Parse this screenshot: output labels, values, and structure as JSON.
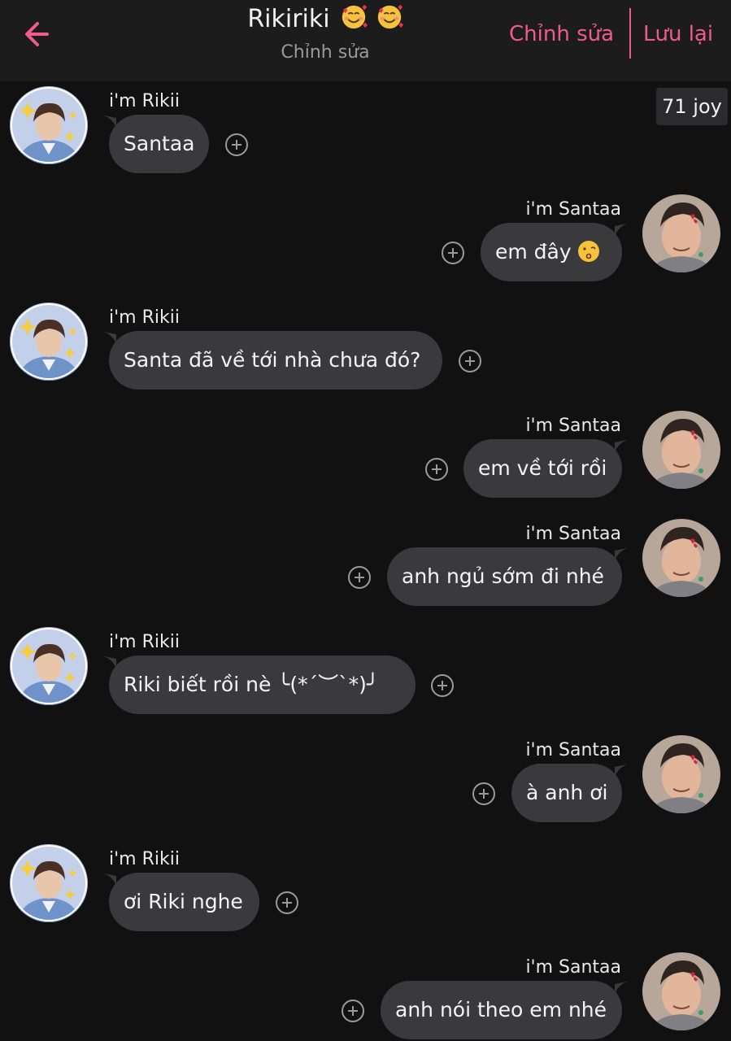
{
  "header": {
    "back_icon": "arrow-left-icon",
    "title": "Rikiriki",
    "title_emoji": "smiling-face-with-hearts",
    "subtitle": "Chỉnh sửa",
    "edit_label": "Chỉnh sửa",
    "save_label": "Lưu lại",
    "accent_color": "#ee5b8c"
  },
  "badge": {
    "text": "71 joy"
  },
  "senders": {
    "left": "i'm Rikii",
    "right": "i'm Santaa"
  },
  "messages": [
    {
      "side": "left",
      "sender": "i'm Rikii",
      "text": "Santaa"
    },
    {
      "side": "right",
      "sender": "i'm Santaa",
      "text": "em đây",
      "emoji": "face-blowing-kiss"
    },
    {
      "side": "left",
      "sender": "i'm Rikii",
      "text": "Santa đã về tới nhà chưa đó?"
    },
    {
      "side": "right",
      "sender": "i'm Santaa",
      "text": "em về tới rồi"
    },
    {
      "side": "right",
      "sender": "i'm Santaa",
      "text": "anh ngủ sớm đi nhé"
    },
    {
      "side": "left",
      "sender": "i'm Rikii",
      "text": "Riki biết rồi nè ╰(*´︶`*)╯"
    },
    {
      "side": "right",
      "sender": "i'm Santaa",
      "text": "à anh ơi"
    },
    {
      "side": "left",
      "sender": "i'm Rikii",
      "text": "ơi Riki nghe"
    },
    {
      "side": "right",
      "sender": "i'm Santaa",
      "text": "anh nói theo em nhé"
    }
  ],
  "colors": {
    "background": "#111112",
    "bubble": "#3a3a3c",
    "header": "#1c1c1d"
  }
}
